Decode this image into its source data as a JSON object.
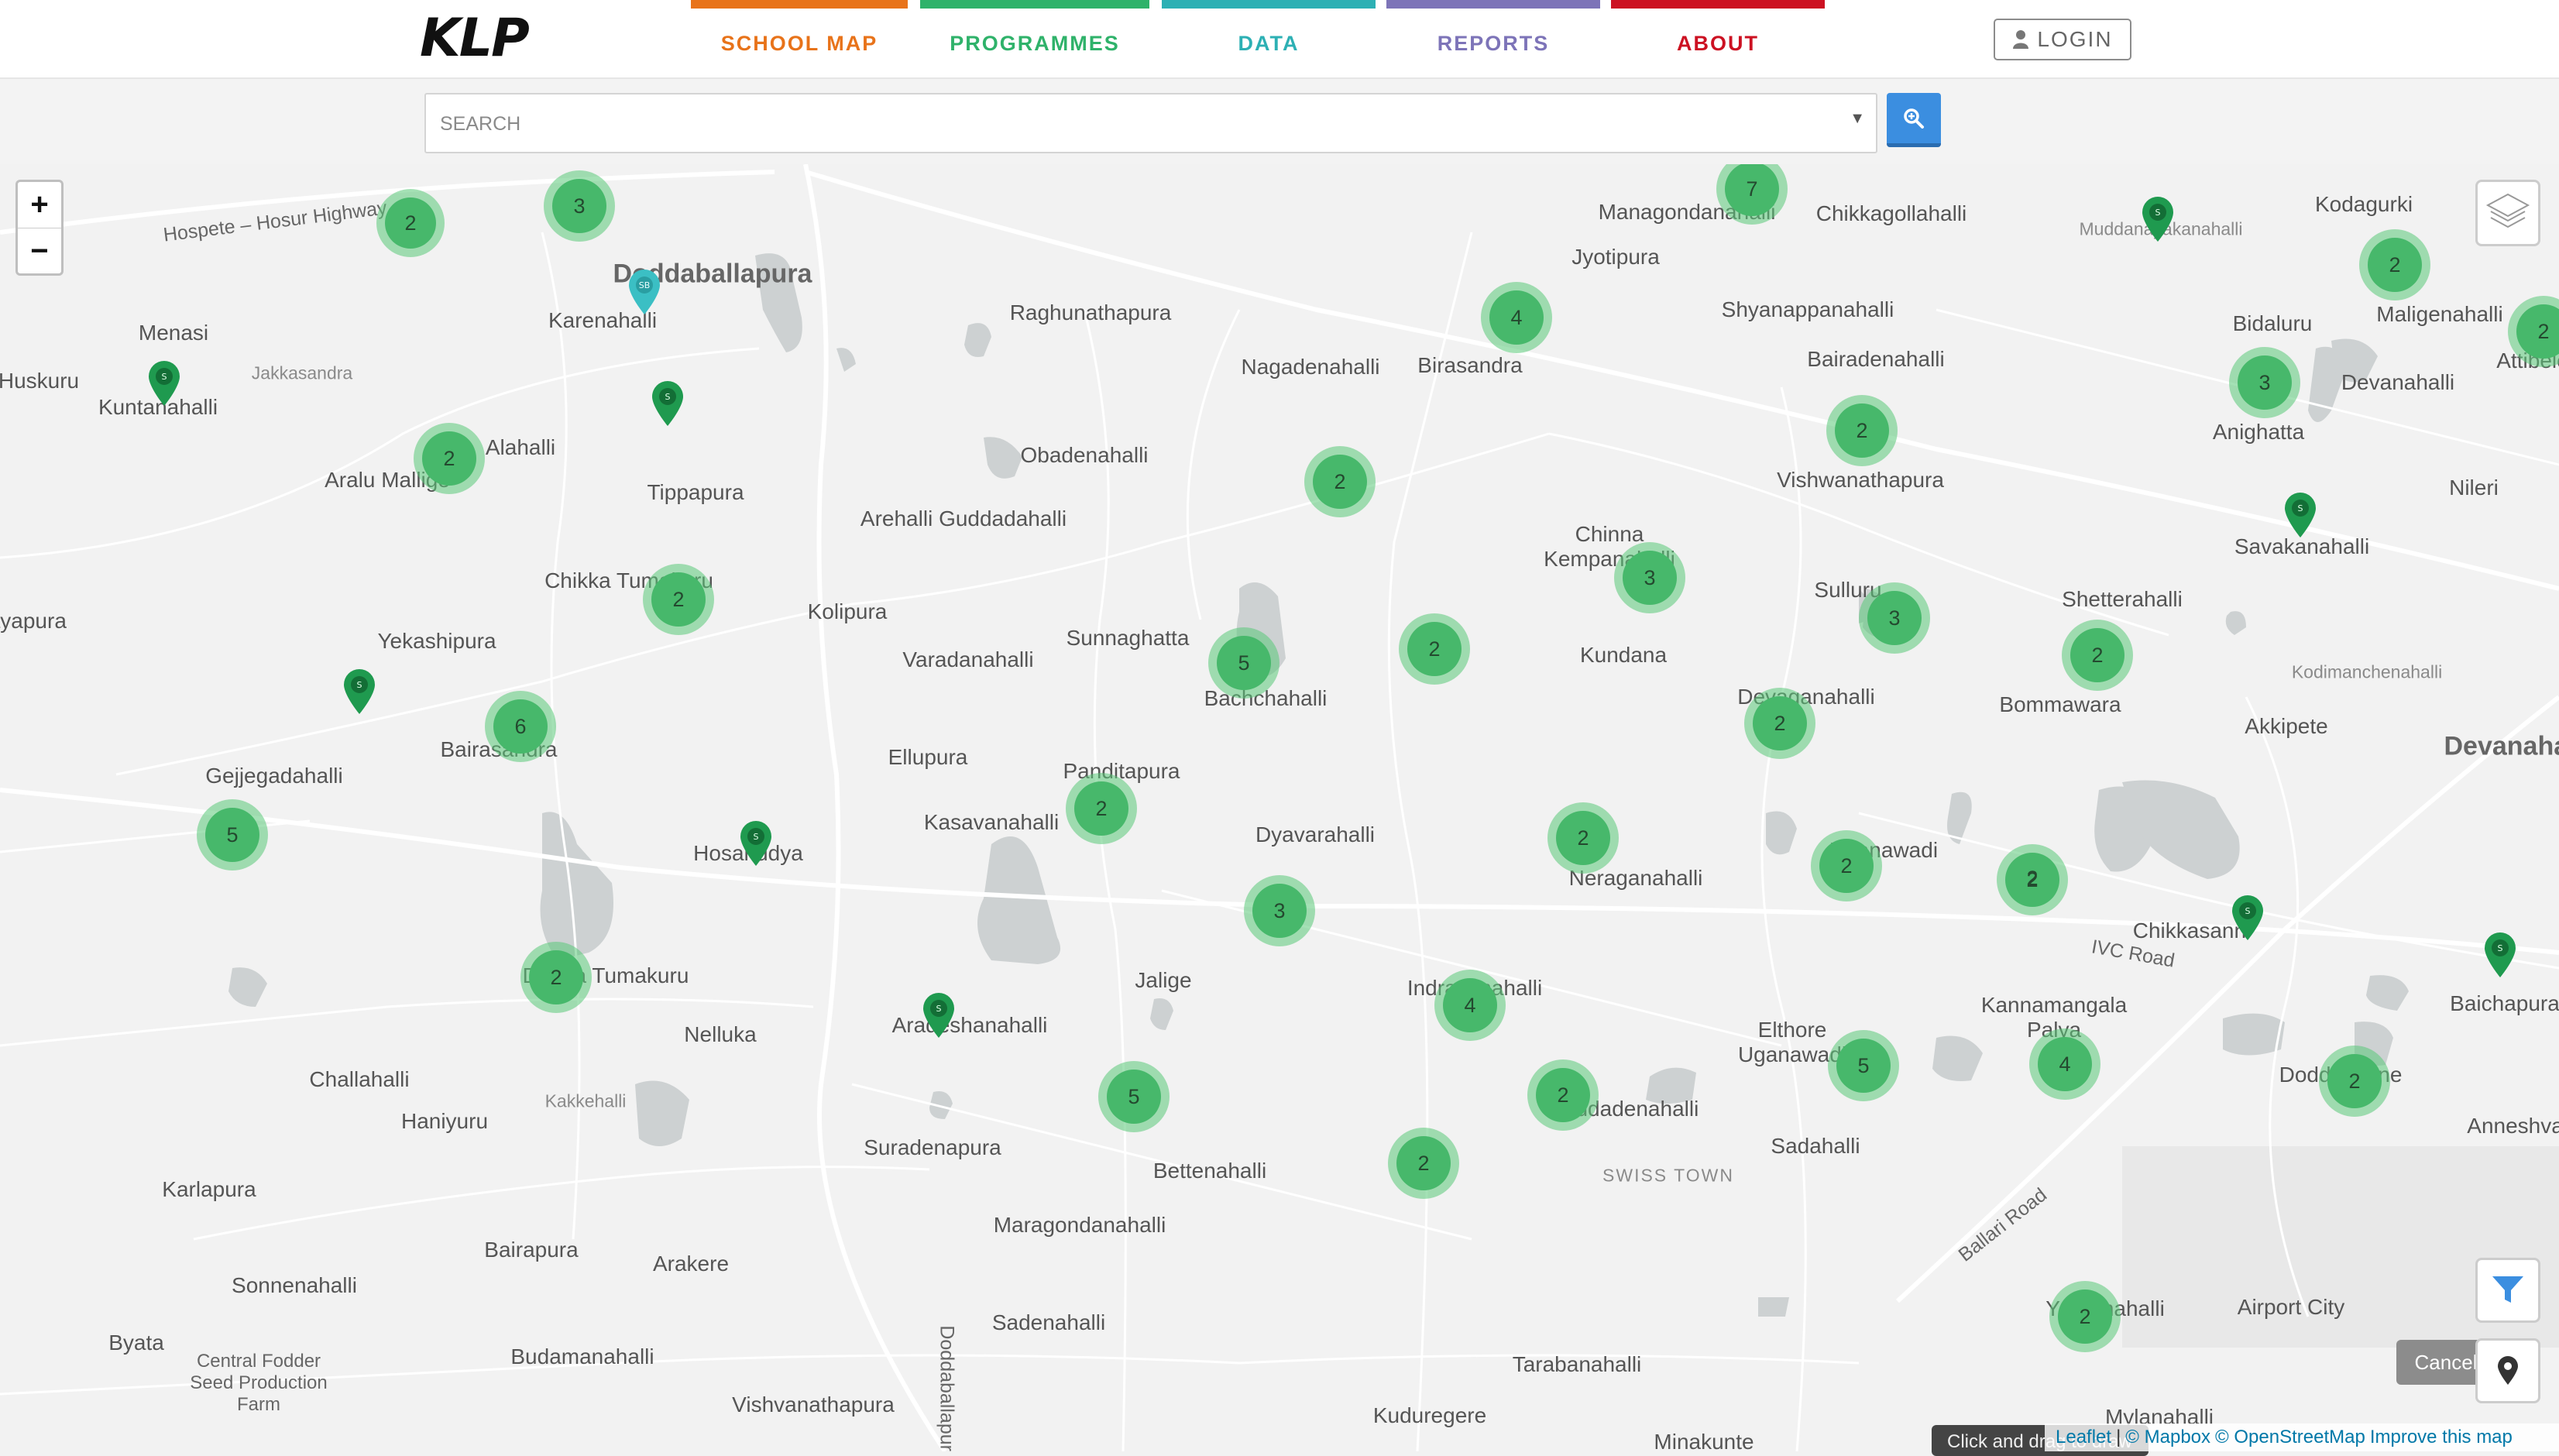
{
  "header": {
    "logo": "KLP",
    "nav": [
      {
        "label": "SCHOOL MAP",
        "color": "#e8731a"
      },
      {
        "label": "PROGRAMMES",
        "color": "#2fb26a"
      },
      {
        "label": "DATA",
        "color": "#2db0b4"
      },
      {
        "label": "REPORTS",
        "color": "#7d74b8"
      },
      {
        "label": "ABOUT",
        "color": "#cc1122"
      }
    ],
    "login_label": "LOGIN"
  },
  "search": {
    "placeholder": "SEARCH"
  },
  "map": {
    "places": [
      "Hospete – Hosur Highway",
      "Doddaballapura",
      "Karenahalli",
      "Menasi",
      "Huskuru",
      "Kuntanahalli",
      "Jakkasandra",
      "Alahalli",
      "Aralu Mallige",
      "Tippapura",
      "Chikka Tumakuru",
      "Yekashipura",
      "Bairasandra",
      "Gejjegadahalli",
      "Hosahudya",
      "Kolipura",
      "Raghunathapura",
      "Obadenahalli",
      "Arehalli Guddadahalli",
      "Varadanahalli",
      "Sunnaghatta",
      "Bachchahalli",
      "Ellupura",
      "Panditapura",
      "Kasavanahalli",
      "Dyavarahalli",
      "Jalige",
      "Nelluka",
      "Challahalli",
      "Haniyuru",
      "Kakkehalli",
      "Karlapura",
      "Bairapura",
      "Arakere",
      "Sonnenahalli",
      "Byata",
      "Budamanahalli",
      "Central Fodder Seed Production Farm",
      "Vishvanathapura",
      "Sadenahalli",
      "Maragondanahalli",
      "Bettenahalli",
      "Suradenapura",
      "Aradeshanahalli",
      "Nagadenahalli",
      "Birasandra",
      "Jyotipura",
      "Managondanahalli",
      "Chikkagollahalli",
      "Shyanappanahalli",
      "Bairadenahalli",
      "Vishwanathapura",
      "Chinna Kempanahalli",
      "Kundana",
      "Devaganahalli",
      "Neraganahalli",
      "Indrasanahalli",
      "Elthore Uganawadi",
      "Uganawadi",
      "Sadahalli",
      "SWISS TOWN",
      "Doddadenahalli",
      "Tarabanahalli",
      "Kuduregere",
      "Minakunte",
      "Shetterahalli",
      "Bommawara",
      "Akkipete",
      "Kodimanchenahalli",
      "Savakanahalli",
      "Nileri",
      "Bidaluru",
      "Devanahalli",
      "Anighatta",
      "Maligenahalli",
      "Kodagurki",
      "Muddanayakanahalli",
      "Chikkasanni",
      "IVC Road",
      "Kannamangala Palya",
      "Doddasanne",
      "Baichapura",
      "Anneshvara",
      "Ballari Road",
      "Airport City",
      "Yarganahalli",
      "Mylanahalli",
      "Doddaballapur Road",
      "Attibele",
      "Dodda Tumakuru",
      "Jyotipura",
      "Sulluru",
      "Vijayapura",
      "Devanahalli"
    ],
    "clusters": [
      2,
      3,
      7,
      2,
      4,
      2,
      2,
      2,
      2,
      3,
      6,
      2,
      5,
      3,
      2,
      3,
      2,
      2,
      5,
      2,
      2,
      2,
      2,
      5,
      3,
      4,
      2,
      2,
      5,
      4,
      2,
      2,
      2,
      2
    ],
    "zoom_in": "+",
    "zoom_out": "−",
    "cancel_label": "Cancel",
    "tooltip": "Click and drag to draw",
    "attribution": {
      "leaflet": "Leaflet",
      "sep": "|",
      "mapbox": "© Mapbox",
      "osm": "© OpenStreetMap",
      "improve": "Improve this map"
    }
  }
}
